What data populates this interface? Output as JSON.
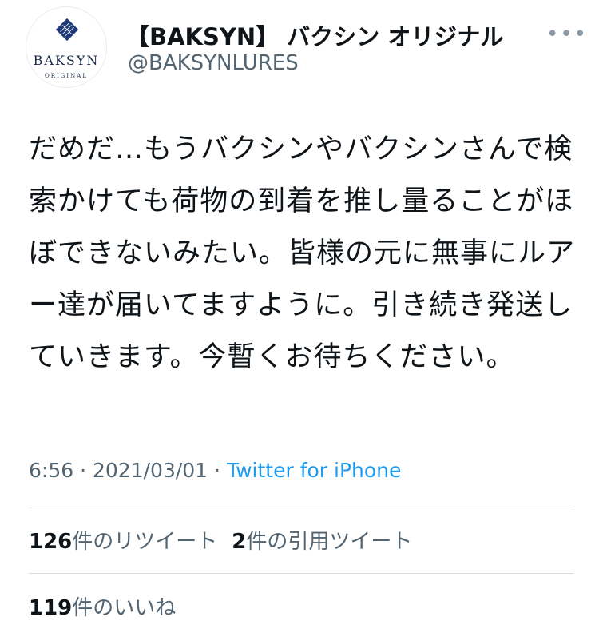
{
  "profile": {
    "avatar": {
      "brand": "BAKSYN",
      "sub": "ORIGINAL"
    },
    "display_name": "【BAKSYN】 バクシン オリジナル",
    "handle": "@BAKSYNLURES",
    "more_label": "•••"
  },
  "tweet": {
    "text": "だめだ…もうバクシンやバクシンさんで検索かけても荷物の到着を推し量ることがほぼできないみたい。皆様の元に無事にルアー達が届いてますように。引き続き発送していきます。今暫くお待ちください。",
    "time": "6:56",
    "date": "2021/03/01",
    "separator": "·",
    "source": "Twitter for iPhone"
  },
  "stats": {
    "retweets": {
      "count": "126",
      "label": "件のリツイート"
    },
    "quotes": {
      "count": "2",
      "label": "件の引用ツイート"
    },
    "likes": {
      "count": "119",
      "label": "件のいいね"
    }
  },
  "colors": {
    "text": "#0f1419",
    "muted": "#536471",
    "link": "#1d9bf0",
    "divider": "#d7dde2",
    "brand": "#1a2a48"
  }
}
